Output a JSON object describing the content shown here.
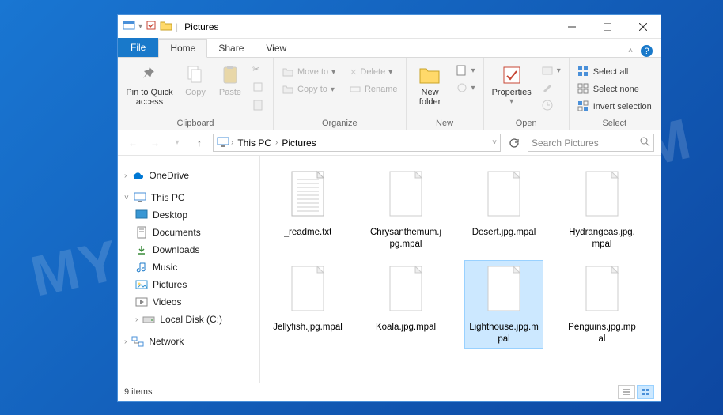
{
  "watermark": "MYANTISPYWARE.COM",
  "window": {
    "title": "Pictures"
  },
  "tabs": {
    "file": "File",
    "home": "Home",
    "share": "Share",
    "view": "View"
  },
  "ribbon": {
    "clipboard": {
      "label": "Clipboard",
      "pin": "Pin to Quick access",
      "copy": "Copy",
      "paste": "Paste"
    },
    "organize": {
      "label": "Organize",
      "move_to": "Move to",
      "copy_to": "Copy to",
      "delete": "Delete",
      "rename": "Rename"
    },
    "new": {
      "label": "New",
      "new_folder": "New folder"
    },
    "open": {
      "label": "Open",
      "properties": "Properties"
    },
    "select": {
      "label": "Select",
      "select_all": "Select all",
      "select_none": "Select none",
      "invert": "Invert selection"
    }
  },
  "breadcrumb": {
    "items": [
      "This PC",
      "Pictures"
    ]
  },
  "search": {
    "placeholder": "Search Pictures"
  },
  "nav": {
    "onedrive": "OneDrive",
    "this_pc": "This PC",
    "desktop": "Desktop",
    "documents": "Documents",
    "downloads": "Downloads",
    "music": "Music",
    "pictures": "Pictures",
    "videos": "Videos",
    "local_disk": "Local Disk (C:)",
    "network": "Network"
  },
  "files": [
    {
      "name": "_readme.txt",
      "type": "txt",
      "selected": false
    },
    {
      "name": "Chrysanthemum.jpg.mpal",
      "type": "blank",
      "selected": false
    },
    {
      "name": "Desert.jpg.mpal",
      "type": "blank",
      "selected": false
    },
    {
      "name": "Hydrangeas.jpg.mpal",
      "type": "blank",
      "selected": false
    },
    {
      "name": "Jellyfish.jpg.mpal",
      "type": "blank",
      "selected": false
    },
    {
      "name": "Koala.jpg.mpal",
      "type": "blank",
      "selected": false
    },
    {
      "name": "Lighthouse.jpg.mpal",
      "type": "blank",
      "selected": true
    },
    {
      "name": "Penguins.jpg.mpal",
      "type": "blank",
      "selected": false
    }
  ],
  "status": {
    "count": "9 items"
  }
}
